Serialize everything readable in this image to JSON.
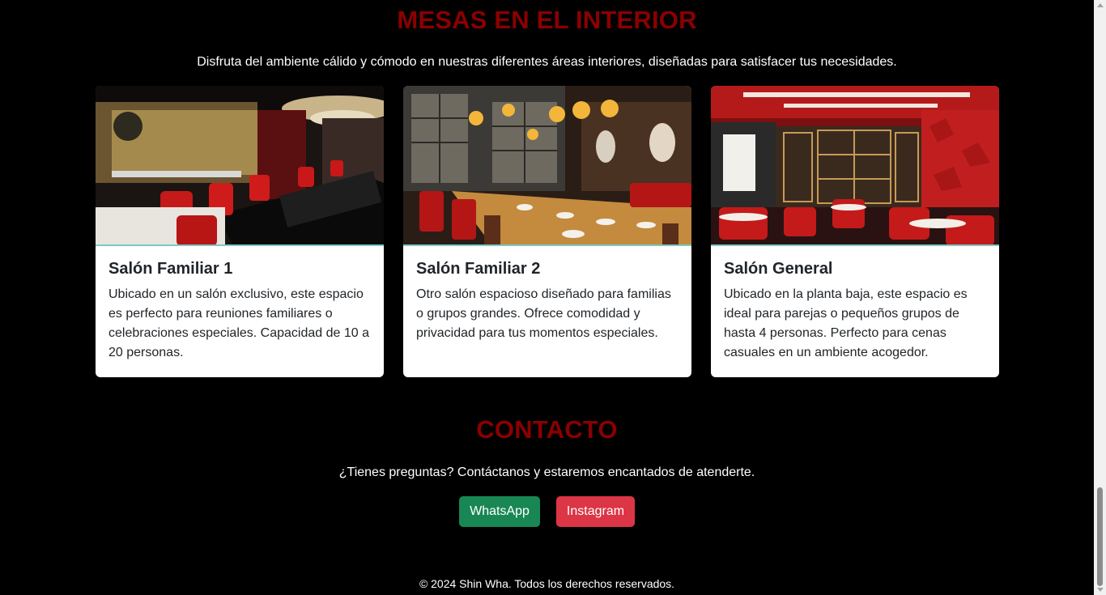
{
  "interior": {
    "title": "MESAS EN EL INTERIOR",
    "lead": "Disfruta del ambiente cálido y cómodo en nuestras diferentes áreas interiores, diseñadas para satisfacer tus necesidades.",
    "cards": [
      {
        "title": "Salón Familiar 1",
        "text": "Ubicado en un salón exclusivo, este espacio es perfecto para reuniones familiares o celebraciones especiales. Capacidad de 10 a 20 personas.",
        "image_icon": "restaurant-photo-icon"
      },
      {
        "title": "Salón Familiar 2",
        "text": "Otro salón espacioso diseñado para familias o grupos grandes. Ofrece comodidad y privacidad para tus momentos especiales.",
        "image_icon": "restaurant-photo-icon"
      },
      {
        "title": "Salón General",
        "text": "Ubicado en la planta baja, este espacio es ideal para parejas o pequeños grupos de hasta 4 personas. Perfecto para cenas casuales en un ambiente acogedor.",
        "image_icon": "restaurant-photo-icon"
      }
    ]
  },
  "contact": {
    "title": "CONTACTO",
    "lead": "¿Tienes preguntas? Contáctanos y estaremos encantados de atenderte.",
    "whatsapp_label": "WhatsApp",
    "instagram_label": "Instagram"
  },
  "footer": {
    "text": "© 2024 Shin Wha. Todos los derechos reservados."
  },
  "colors": {
    "background": "#000000",
    "title_red": "#8b0000",
    "whatsapp_green": "#198754",
    "instagram_red": "#dc3545",
    "card_accent": "#7ec8c4"
  }
}
